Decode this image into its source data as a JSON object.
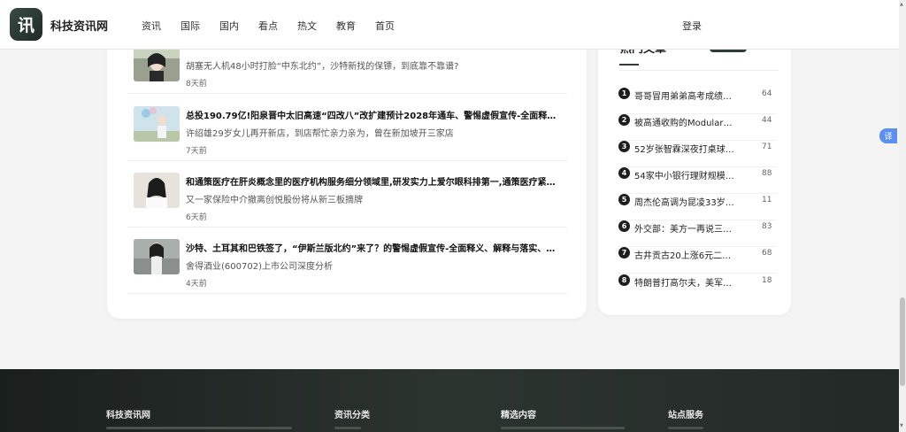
{
  "header": {
    "logo_char": "讯",
    "site_name": "科技资讯网",
    "nav": [
      "资讯",
      "国际",
      "国内",
      "看点",
      "热文",
      "教育",
      "首页"
    ],
    "login": "登录"
  },
  "articles": [
    {
      "title": "…",
      "subtitle": "胡塞无人机48小时打脸“中东北约”，沙特新找的保镖，到底靠不靠谱?",
      "time": "8天前"
    },
    {
      "title": "总投190.79亿!阳泉晋中太旧高速“四改八”改扩建预计2028年通车、警惕虚假宣传-全面释义、统计…",
      "subtitle": "许绍雄29岁女儿再开新店，到店帮忙亲力亲为，曾在新加坡开三家店",
      "time": "7天前"
    },
    {
      "title": "和通策医疗在肝炎概念里的医疗机构服务细分领域里,研发实力上爱尔眼科排第一,通策医疗紧跟其后…",
      "subtitle": "又一家保险中介撤离创悦股份将从新三板摘牌",
      "time": "6天前"
    },
    {
      "title": "沙特、土耳其和巴铁签了，“伊斯兰版北约”来了？的警惕虚假宣传-全面释义、解释与落实、科学解…",
      "subtitle": "舍得酒业(600702)上市公司深度分析",
      "time": "4天前"
    }
  ],
  "sidebar": {
    "title": "热门文章",
    "items": [
      {
        "num": "1",
        "title": "哥哥冒用弟弟高考成绩…",
        "count": "64"
      },
      {
        "num": "2",
        "title": "被高通收购的Modular，…",
        "count": "44"
      },
      {
        "num": "3",
        "title": "52岁张智霖深夜打桌球…",
        "count": "71"
      },
      {
        "num": "4",
        "title": "54家中小银行理财规模…",
        "count": "88"
      },
      {
        "num": "5",
        "title": "周杰伦高调为昆凌33岁…",
        "count": "11"
      },
      {
        "num": "6",
        "title": "外交部：美方一再说三…",
        "count": "83"
      },
      {
        "num": "7",
        "title": "古井贡古20上涨6元二连…",
        "count": "68"
      },
      {
        "num": "8",
        "title": "特朗普打高尔夫，美军“…",
        "count": "18"
      }
    ]
  },
  "translate_label": "译",
  "footer": {
    "col1": "科技资讯网",
    "col2": "资讯分类",
    "col3": "精选内容",
    "col4": "站点服务"
  },
  "colors": {
    "accent": "#2f3d38",
    "footer_bg": "#232927",
    "translate": "#5b8ff0"
  }
}
